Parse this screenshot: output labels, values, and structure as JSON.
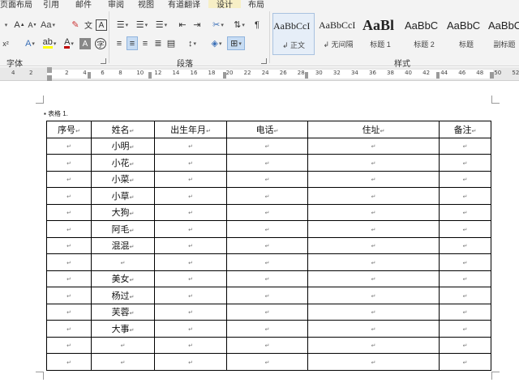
{
  "tabs": [
    "页面布局",
    "引用",
    "邮件",
    "审阅",
    "视图",
    "有道翻译",
    "设计",
    "布局"
  ],
  "ribbon": {
    "font_group_label": "字体",
    "paragraph_group_label": "段落",
    "styles_group_label": "样式",
    "styles": [
      {
        "sample": "AaBbCcI",
        "name": "正文"
      },
      {
        "sample": "AaBbCcI",
        "name": "无间隔"
      },
      {
        "sample": "AaBl",
        "name": "标题 1"
      },
      {
        "sample": "AaBbC",
        "name": "标题 2"
      },
      {
        "sample": "AaBbC",
        "name": "标题"
      },
      {
        "sample": "AaBbC",
        "name": "副标题"
      }
    ],
    "font_color": "#c00000",
    "highlight_color": "#ffff00"
  },
  "ruler": {
    "ticks": [
      "4",
      "2",
      "",
      "2",
      "4",
      "6",
      "8",
      "10",
      "12",
      "14",
      "16",
      "18",
      "20",
      "22",
      "24",
      "26",
      "28",
      "30",
      "32",
      "34",
      "36",
      "38",
      "40",
      "42",
      "44",
      "46",
      "48",
      "50",
      "52"
    ]
  },
  "document": {
    "caption": "表格 1.",
    "table": {
      "headers": [
        "序号",
        "姓名",
        "出生年月",
        "电话",
        "住址",
        "备注"
      ],
      "names": [
        "小明",
        "小花",
        "小菜",
        "小草",
        "大狗",
        "阿毛",
        "混混",
        "",
        "美女",
        "杨过",
        "芙蓉",
        "大事",
        "",
        ""
      ]
    },
    "paragraph_mark": "↵"
  }
}
